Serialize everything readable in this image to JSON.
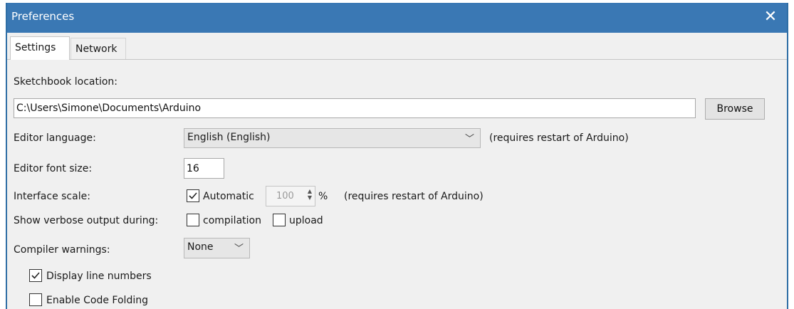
{
  "window": {
    "title": "Preferences",
    "close_glyph": "✕"
  },
  "tabs": [
    {
      "label": "Settings",
      "active": true
    },
    {
      "label": "Network",
      "active": false
    }
  ],
  "sketchbook": {
    "label": "Sketchbook location:",
    "value": "C:\\Users\\Simone\\Documents\\Arduino",
    "browse_label": "Browse"
  },
  "editor_language": {
    "label": "Editor language:",
    "value": "English (English)",
    "note": "(requires restart of Arduino)"
  },
  "editor_font_size": {
    "label": "Editor font size:",
    "value": "16"
  },
  "interface_scale": {
    "label": "Interface scale:",
    "automatic_label": "Automatic",
    "automatic_checked": true,
    "value": "100",
    "unit": "%",
    "note": "(requires restart of Arduino)"
  },
  "verbose": {
    "label": "Show verbose output during:",
    "compilation_label": "compilation",
    "compilation_checked": false,
    "upload_label": "upload",
    "upload_checked": false
  },
  "compiler_warnings": {
    "label": "Compiler warnings:",
    "value": "None"
  },
  "display_line_numbers": {
    "label": "Display line numbers",
    "checked": true
  },
  "code_folding": {
    "label": "Enable Code Folding",
    "checked": false
  },
  "icons": {
    "close": "close-icon",
    "dropdown": "chevron-down-icon",
    "check": "checkmark-icon",
    "spin": "spin-arrows-icon"
  },
  "colors": {
    "titlebar": "#3a78b4",
    "window_bg": "#f0f0f0"
  }
}
